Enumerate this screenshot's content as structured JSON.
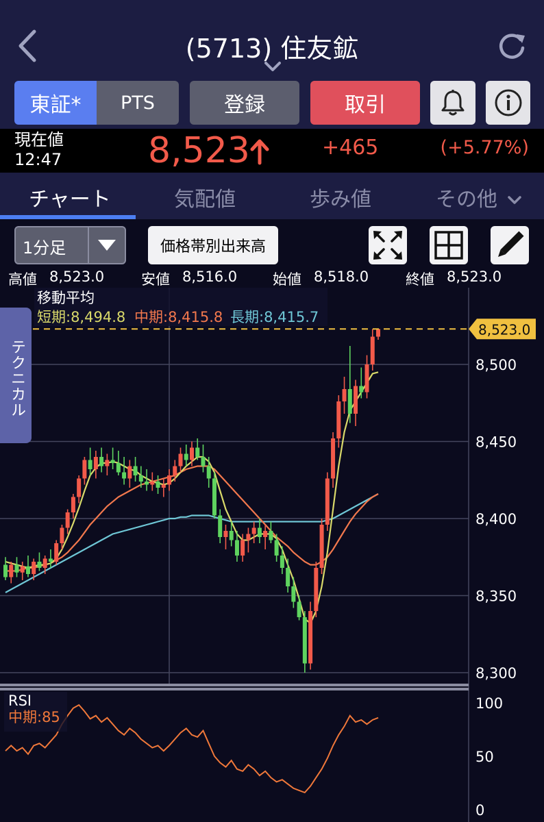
{
  "header": {
    "title": "(5713) 住友鉱"
  },
  "buttons": {
    "market_tosho": "東証*",
    "market_pts": "PTS",
    "register": "登録",
    "trade": "取引"
  },
  "price": {
    "label": "現在値",
    "time": "12:47",
    "value": "8,523",
    "change": "+465",
    "change_pct": "(+5.77%)"
  },
  "tabs": [
    {
      "label": "チャート",
      "active": true
    },
    {
      "label": "気配値",
      "active": false
    },
    {
      "label": "歩み値",
      "active": false
    },
    {
      "label": "その他",
      "active": false
    }
  ],
  "toolbar": {
    "interval": "1分足",
    "volume_profile": "価格帯別出来高"
  },
  "ohlc": {
    "high_label": "高値",
    "high": "8,523.0",
    "low_label": "安値",
    "low": "8,516.0",
    "open_label": "始値",
    "open": "8,518.0",
    "close_label": "終値",
    "close": "8,523.0"
  },
  "technical_label": "テクニカル",
  "colors": {
    "up": "#f25a4a",
    "down": "#5fd35f",
    "ma_short": "#d9d96a",
    "ma_mid": "#f2784d",
    "ma_long": "#6fc7d6",
    "rsi": "#f0783a",
    "price_tag": "#f0c040"
  },
  "chart_data": {
    "type": "candlestick",
    "ma_legend_title": "移動平均",
    "ma_legend": [
      {
        "label": "短期:8,494.8"
      },
      {
        "label": "中期:8,415.8"
      },
      {
        "label": "長期:8,415.7"
      }
    ],
    "price_axis": {
      "ylim": [
        8300,
        8523
      ],
      "ticks": [
        "8,500",
        "8,450",
        "8,400",
        "8,350",
        "8,300"
      ],
      "tick_values": [
        8500,
        8450,
        8400,
        8350,
        8300
      ],
      "current_price_tag": "8,523.0",
      "current_price": 8523
    },
    "candles": [
      [
        8370,
        8375,
        8360,
        8362
      ],
      [
        8362,
        8372,
        8358,
        8370
      ],
      [
        8370,
        8375,
        8362,
        8365
      ],
      [
        8365,
        8372,
        8360,
        8369
      ],
      [
        8369,
        8376,
        8362,
        8364
      ],
      [
        8364,
        8374,
        8360,
        8372
      ],
      [
        8372,
        8378,
        8366,
        8368
      ],
      [
        8368,
        8376,
        8364,
        8374
      ],
      [
        8374,
        8380,
        8368,
        8372
      ],
      [
        8372,
        8386,
        8370,
        8384
      ],
      [
        8384,
        8396,
        8380,
        8394
      ],
      [
        8394,
        8406,
        8390,
        8404
      ],
      [
        8404,
        8416,
        8400,
        8414
      ],
      [
        8414,
        8428,
        8410,
        8426
      ],
      [
        8426,
        8440,
        8422,
        8438
      ],
      [
        8438,
        8446,
        8428,
        8432
      ],
      [
        8432,
        8444,
        8426,
        8440
      ],
      [
        8440,
        8446,
        8430,
        8434
      ],
      [
        8434,
        8442,
        8428,
        8438
      ],
      [
        8438,
        8446,
        8432,
        8436
      ],
      [
        8436,
        8444,
        8428,
        8430
      ],
      [
        8430,
        8440,
        8422,
        8426
      ],
      [
        8426,
        8438,
        8420,
        8434
      ],
      [
        8434,
        8440,
        8424,
        8428
      ],
      [
        8428,
        8434,
        8420,
        8424
      ],
      [
        8424,
        8432,
        8418,
        8422
      ],
      [
        8422,
        8430,
        8418,
        8424
      ],
      [
        8424,
        8428,
        8416,
        8420
      ],
      [
        8420,
        8426,
        8414,
        8422
      ],
      [
        8422,
        8432,
        8418,
        8428
      ],
      [
        8428,
        8438,
        8424,
        8434
      ],
      [
        8434,
        8446,
        8430,
        8442
      ],
      [
        8442,
        8448,
        8434,
        8438
      ],
      [
        8438,
        8450,
        8434,
        8446
      ],
      [
        8446,
        8452,
        8438,
        8440
      ],
      [
        8440,
        8448,
        8430,
        8434
      ],
      [
        8434,
        8440,
        8420,
        8426
      ],
      [
        8426,
        8430,
        8400,
        8402
      ],
      [
        8402,
        8406,
        8384,
        8388
      ],
      [
        8388,
        8396,
        8380,
        8392
      ],
      [
        8392,
        8398,
        8382,
        8386
      ],
      [
        8386,
        8392,
        8372,
        8376
      ],
      [
        8376,
        8390,
        8372,
        8386
      ],
      [
        8386,
        8394,
        8378,
        8390
      ],
      [
        8390,
        8398,
        8384,
        8394
      ],
      [
        8394,
        8400,
        8384,
        8388
      ],
      [
        8388,
        8396,
        8380,
        8392
      ],
      [
        8392,
        8398,
        8384,
        8386
      ],
      [
        8386,
        8390,
        8372,
        8376
      ],
      [
        8376,
        8382,
        8364,
        8368
      ],
      [
        8368,
        8374,
        8352,
        8356
      ],
      [
        8356,
        8362,
        8342,
        8346
      ],
      [
        8346,
        8350,
        8334,
        8336
      ],
      [
        8336,
        8340,
        8300,
        8306
      ],
      [
        8306,
        8346,
        8302,
        8340
      ],
      [
        8340,
        8372,
        8336,
        8368
      ],
      [
        8368,
        8400,
        8364,
        8396
      ],
      [
        8396,
        8430,
        8392,
        8426
      ],
      [
        8426,
        8456,
        8420,
        8452
      ],
      [
        8452,
        8480,
        8446,
        8476
      ],
      [
        8476,
        8492,
        8468,
        8484
      ],
      [
        8484,
        8512,
        8462,
        8468
      ],
      [
        8468,
        8490,
        8460,
        8486
      ],
      [
        8486,
        8498,
        8478,
        8482
      ],
      [
        8482,
        8506,
        8478,
        8500
      ],
      [
        8500,
        8523,
        8496,
        8518
      ],
      [
        8518,
        8523,
        8516,
        8523
      ]
    ],
    "ma_short": [
      8372,
      8371,
      8370,
      8369,
      8368,
      8369,
      8370,
      8370,
      8371,
      8374,
      8380,
      8388,
      8397,
      8407,
      8418,
      8428,
      8433,
      8436,
      8436,
      8437,
      8436,
      8434,
      8432,
      8431,
      8428,
      8426,
      8424,
      8423,
      8422,
      8423,
      8426,
      8430,
      8434,
      8437,
      8440,
      8440,
      8437,
      8430,
      8418,
      8406,
      8398,
      8390,
      8386,
      8386,
      8388,
      8390,
      8390,
      8390,
      8387,
      8380,
      8370,
      8360,
      8348,
      8335,
      8332,
      8340,
      8356,
      8378,
      8406,
      8434,
      8456,
      8470,
      8476,
      8482,
      8488,
      8494,
      8495
    ],
    "ma_mid": [
      8366,
      8366,
      8366,
      8367,
      8368,
      8368,
      8369,
      8370,
      8371,
      8373,
      8375,
      8378,
      8382,
      8386,
      8391,
      8396,
      8400,
      8404,
      8408,
      8411,
      8414,
      8416,
      8418,
      8420,
      8422,
      8423,
      8424,
      8425,
      8426,
      8427,
      8428,
      8430,
      8432,
      8433,
      8434,
      8434,
      8434,
      8432,
      8428,
      8424,
      8420,
      8416,
      8412,
      8408,
      8404,
      8400,
      8396,
      8392,
      8388,
      8385,
      8382,
      8378,
      8375,
      8372,
      8370,
      8370,
      8372,
      8375,
      8380,
      8386,
      8392,
      8398,
      8403,
      8407,
      8411,
      8414,
      8416
    ],
    "ma_long": [
      8352,
      8354,
      8356,
      8358,
      8360,
      8362,
      8364,
      8366,
      8368,
      8370,
      8372,
      8374,
      8376,
      8378,
      8380,
      8382,
      8384,
      8386,
      8388,
      8390,
      8391,
      8392,
      8393,
      8394,
      8395,
      8396,
      8397,
      8398,
      8399,
      8400,
      8400,
      8401,
      8401,
      8402,
      8402,
      8402,
      8402,
      8401,
      8400,
      8399,
      8398,
      8398,
      8398,
      8398,
      8398,
      8398,
      8398,
      8398,
      8398,
      8398,
      8398,
      8398,
      8398,
      8398,
      8398,
      8398,
      8398,
      8399,
      8400,
      8402,
      8404,
      8406,
      8408,
      8410,
      8412,
      8414,
      8416
    ],
    "rsi": {
      "title": "RSI",
      "mid_label": "中期:85",
      "ticks": [
        "100",
        "50",
        "0"
      ],
      "ylim": [
        0,
        100
      ],
      "values": [
        55,
        60,
        55,
        58,
        52,
        60,
        62,
        58,
        64,
        70,
        80,
        88,
        95,
        98,
        92,
        85,
        88,
        82,
        86,
        80,
        74,
        70,
        76,
        72,
        66,
        62,
        58,
        60,
        55,
        60,
        66,
        72,
        76,
        70,
        68,
        74,
        62,
        50,
        44,
        40,
        46,
        38,
        36,
        42,
        38,
        32,
        36,
        30,
        26,
        28,
        24,
        20,
        18,
        16,
        22,
        30,
        38,
        48,
        60,
        70,
        78,
        88,
        82,
        84,
        80,
        84,
        86
      ]
    }
  }
}
